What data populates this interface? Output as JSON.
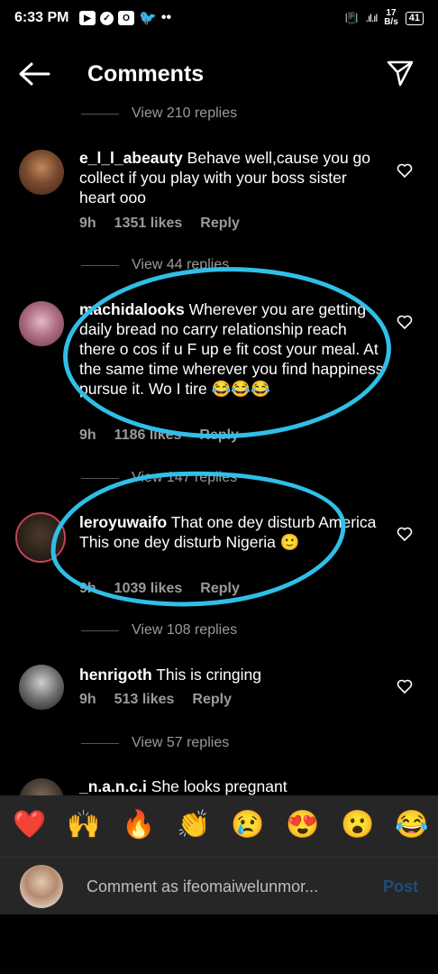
{
  "status": {
    "time": "6:33 PM",
    "net_speed_top": "17",
    "net_speed_bottom": "B/s",
    "battery": "41"
  },
  "header": {
    "title": "Comments"
  },
  "replies": [
    {
      "label": "View 210 replies"
    },
    {
      "label": "View 44 replies"
    },
    {
      "label": "View 147 replies"
    },
    {
      "label": "View 108 replies"
    },
    {
      "label": "View 57 replies"
    }
  ],
  "comments": [
    {
      "username": "e_l_l_abeauty",
      "text": "Behave well,cause you go collect if you play with your boss sister heart ooo",
      "time": "9h",
      "likes": "1351 likes",
      "reply": "Reply"
    },
    {
      "username": "machidalooks",
      "text": "Wherever you are getting daily bread no carry relationship reach there o cos if u F up e fit cost your meal. At the same time wherever you find happiness pursue it. Wo I tire 😂😂😂",
      "time": "9h",
      "likes": "1186 likes",
      "reply": "Reply"
    },
    {
      "username": "leroyuwaifo",
      "text": "That one dey disturb America\nThis one dey disturb Nigeria 🙂",
      "time": "9h",
      "likes": "1039 likes",
      "reply": "Reply"
    },
    {
      "username": "henrigoth",
      "text": "This is cringing",
      "time": "9h",
      "likes": "513 likes",
      "reply": "Reply"
    },
    {
      "username": "_n.a.n.c.i",
      "text": "She looks pregnant"
    }
  ],
  "reactions": [
    "❤️",
    "🙌",
    "🔥",
    "👏",
    "😢",
    "😍",
    "😮",
    "😂"
  ],
  "composer": {
    "placeholder": "Comment as ifeomaiwelunmor...",
    "post_label": "Post"
  },
  "colors": {
    "annotation": "#2fbfe7",
    "meta_text": "#9a9a9a",
    "post_disabled": "#1f4d80"
  }
}
